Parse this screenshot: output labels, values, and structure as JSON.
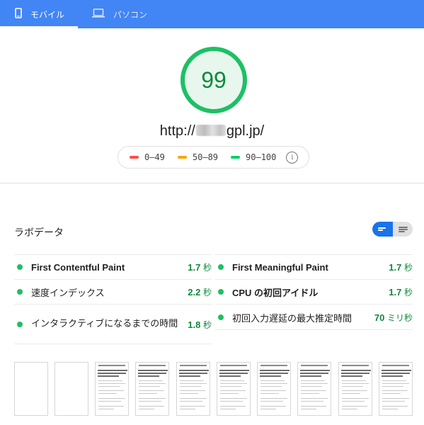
{
  "tabs": [
    {
      "label": "モバイル",
      "icon": "smartphone-icon",
      "selected": true
    },
    {
      "label": "パソコン",
      "icon": "laptop-icon",
      "selected": false
    }
  ],
  "score": {
    "value": "99"
  },
  "url": {
    "prefix": "http://",
    "suffix": "gpl.jp/"
  },
  "legend": [
    {
      "range": "0–49",
      "color": "#ff4e42"
    },
    {
      "range": "50–89",
      "color": "#ffa400"
    },
    {
      "range": "90–100",
      "color": "#0cce6b"
    }
  ],
  "lab": {
    "title": "ラボデータ",
    "metrics": [
      {
        "label": "First Contentful Paint",
        "value": "1.7",
        "unit": "秒"
      },
      {
        "label": "First Meaningful Paint",
        "value": "1.7",
        "unit": "秒"
      },
      {
        "label": "速度インデックス",
        "value": "2.2",
        "unit": "秒"
      },
      {
        "label": "CPU の初回アイドル",
        "value": "1.7",
        "unit": "秒"
      },
      {
        "label": "インタラクティブになるまでの時間",
        "value": "1.8",
        "unit": "秒"
      },
      {
        "label": "初回入力遅延の最大推定時間",
        "value": "70",
        "unit": "ミリ秒"
      }
    ]
  },
  "filmstrip": {
    "frames": 10,
    "blank_frames": 2
  },
  "colors": {
    "accent": "#4285f4",
    "pass": "#0cce6b",
    "pass_text": "#0b8a3b"
  }
}
